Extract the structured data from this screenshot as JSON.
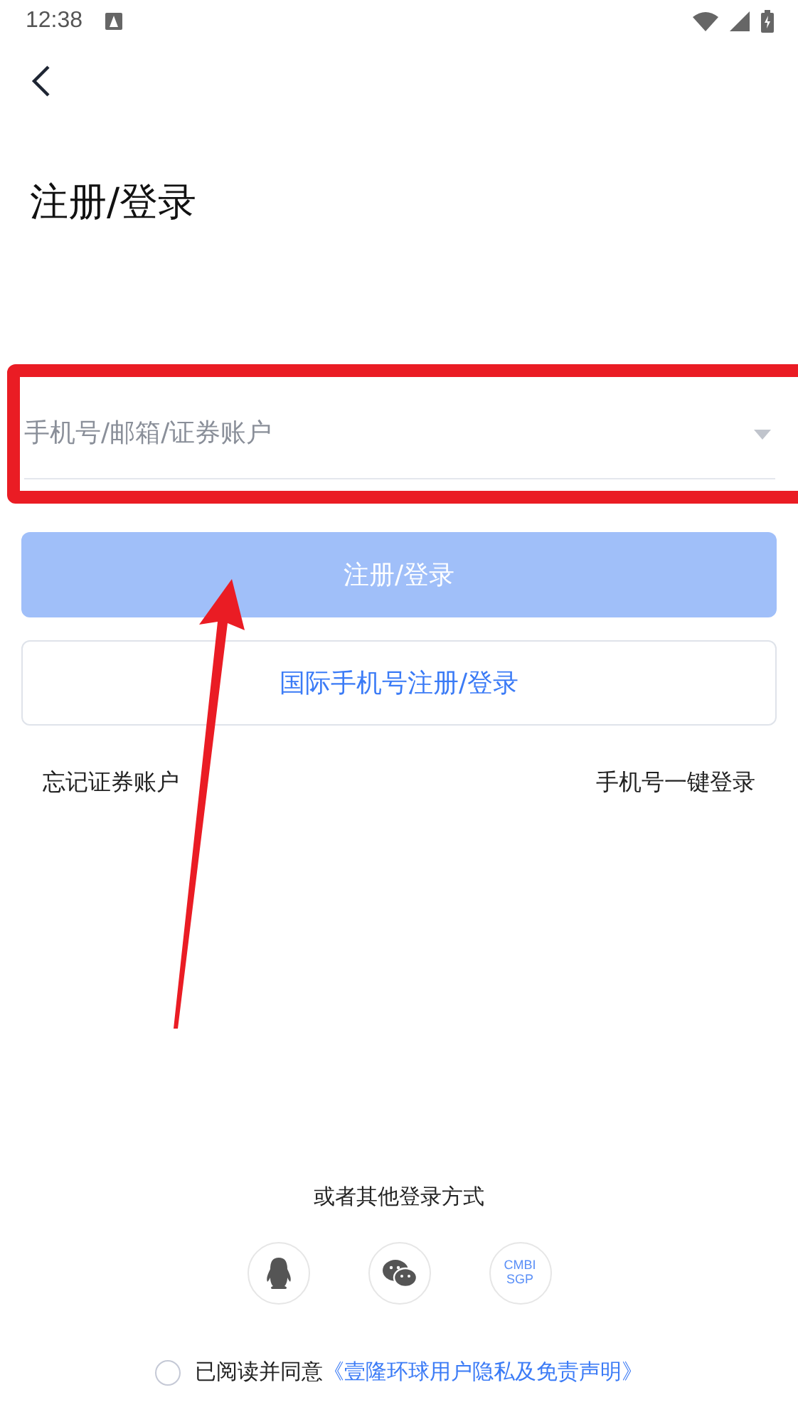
{
  "status_bar": {
    "time": "12:38"
  },
  "title": "注册/登录",
  "account_field": {
    "placeholder": "手机号/邮箱/证券账户"
  },
  "submit_button": {
    "label": "注册/登录",
    "disabled": true
  },
  "intl_button": {
    "label": "国际手机号注册/登录"
  },
  "links": [
    "忘记证券账户",
    "手机号一键登录"
  ],
  "other_login": {
    "heading": "或者其他登录方式",
    "options": [
      {
        "kind": "qq"
      },
      {
        "kind": "wechat"
      },
      {
        "kind": "text",
        "label": "CMBI SGP"
      }
    ]
  },
  "agreement": {
    "checked": false,
    "text": "已阅读并同意",
    "link": "《壹隆环球用户隐私及免责声明》"
  },
  "annotation": {
    "highlight": true,
    "arrow": true
  }
}
